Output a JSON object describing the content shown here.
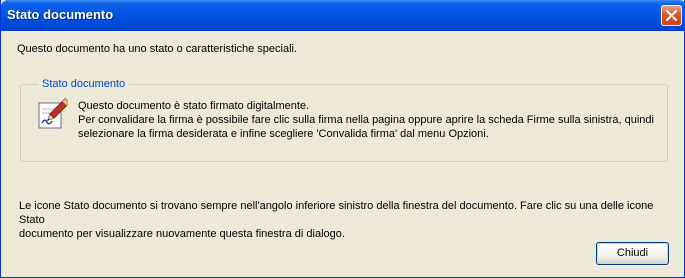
{
  "window": {
    "title": "Stato documento"
  },
  "intro_text": "Questo documento ha uno stato o caratteristiche speciali.",
  "group": {
    "legend": "Stato documento",
    "icon": "signature-pen-icon",
    "lines": [
      "Questo documento è stato firmato digitalmente.",
      "Per convalidare la firma è possibile fare clic sulla firma nella pagina oppure aprire la scheda Firme sulla sinistra, quindi",
      "selezionare la firma desiderata e infine scegliere 'Convalida firma' dal menu Opzioni."
    ]
  },
  "footer_lines": [
    "Le icone Stato documento si trovano sempre nell'angolo inferiore sinistro della finestra del documento. Fare clic su una delle icone Stato",
    "documento per visualizzare nuovamente questa finestra di dialogo."
  ],
  "buttons": {
    "close_label": "Chiudi"
  },
  "colors": {
    "titlebar": "#0055e5",
    "legend": "#0046d5",
    "dialog_bg": "#ece9d8",
    "close_button": "#d9592e"
  }
}
